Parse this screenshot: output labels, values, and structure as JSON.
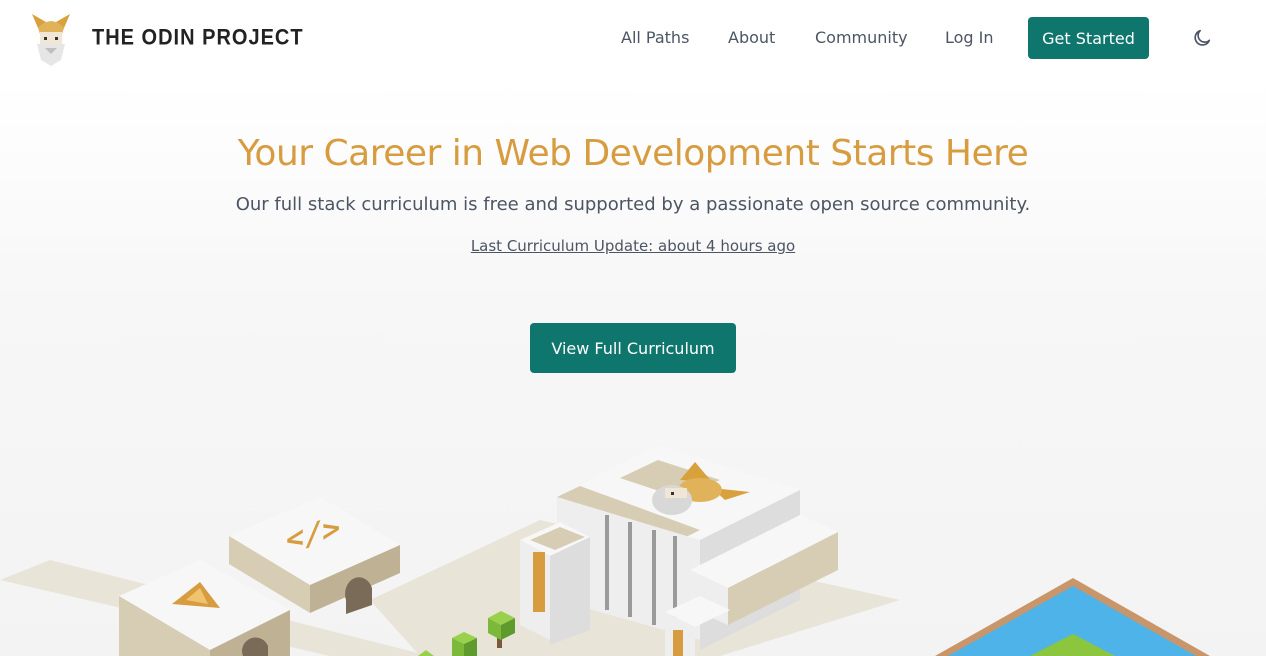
{
  "nav": {
    "brand": "THE ODIN PROJECT",
    "links": [
      "All Paths",
      "About",
      "Community",
      "Log In"
    ],
    "cta": "Get Started",
    "theme_icon": "moon-icon"
  },
  "hero": {
    "title": "Your Career in Web Development Starts Here",
    "subtitle": "Our full stack curriculum is free and supported by a passionate open source community.",
    "update_link": "Last Curriculum Update: about 4 hours ago",
    "cta": "View Full Curriculum"
  },
  "illustration": {
    "code_symbol": "</>"
  },
  "colors": {
    "primary": "#0f766e",
    "accent": "#d79c3f",
    "text": "#4b5563",
    "water": "#4db3e8",
    "grass": "#8cc63f"
  }
}
